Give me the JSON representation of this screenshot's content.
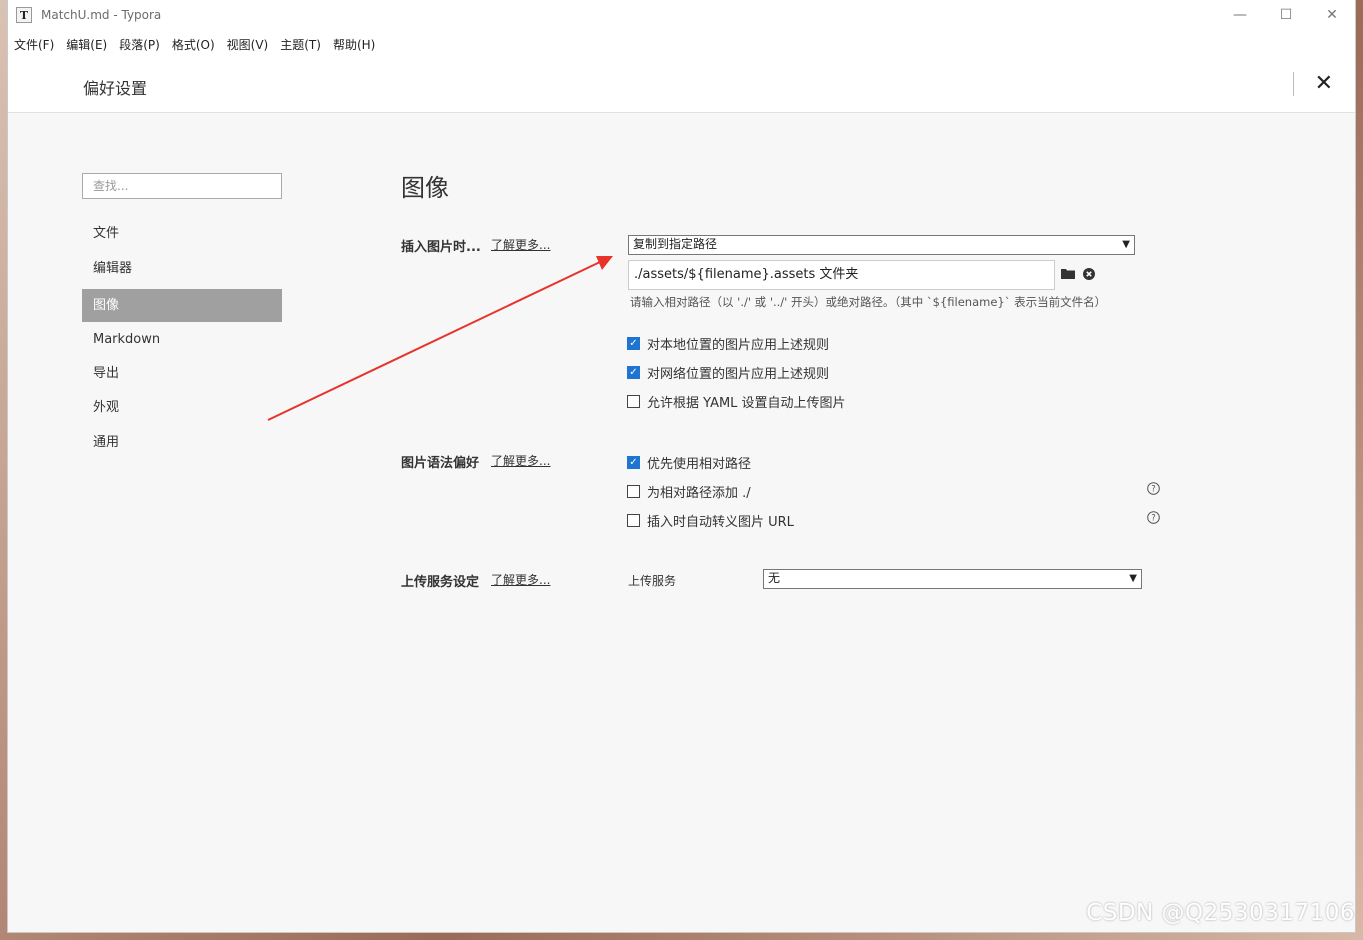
{
  "window": {
    "title": "MatchU.md - Typora",
    "app_icon_letter": "T",
    "controls": {
      "minimize": "—",
      "maximize": "☐",
      "close": "✕"
    }
  },
  "menubar": {
    "items": [
      "文件(F)",
      "编辑(E)",
      "段落(P)",
      "格式(O)",
      "视图(V)",
      "主题(T)",
      "帮助(H)"
    ]
  },
  "preferences": {
    "title": "偏好设置",
    "close_label": "✕"
  },
  "sidebar": {
    "search_placeholder": "查找...",
    "items": [
      {
        "label": "文件",
        "active": false
      },
      {
        "label": "编辑器",
        "active": false
      },
      {
        "label": "图像",
        "active": true
      },
      {
        "label": "Markdown",
        "active": false
      },
      {
        "label": "导出",
        "active": false
      },
      {
        "label": "外观",
        "active": false
      },
      {
        "label": "通用",
        "active": false
      }
    ]
  },
  "main": {
    "section_title": "图像",
    "learn_more": "了解更多...",
    "insert": {
      "label": "插入图片时...",
      "action_value": "复制到指定路径",
      "path_value": "./assets/${filename}.assets 文件夹",
      "hint": "请输入相对路径（以 './' 或 '../' 开头）或绝对路径。（其中 `${filename}` 表示当前文件名）",
      "options": [
        {
          "label": "对本地位置的图片应用上述规则",
          "checked": true
        },
        {
          "label": "对网络位置的图片应用上述规则",
          "checked": true
        },
        {
          "label": "允许根据 YAML 设置自动上传图片",
          "checked": false
        }
      ]
    },
    "syntax": {
      "label": "图片语法偏好",
      "options": [
        {
          "label": "优先使用相对路径",
          "checked": true,
          "help": false
        },
        {
          "label": "为相对路径添加 ./",
          "checked": false,
          "help": true
        },
        {
          "label": "插入时自动转义图片 URL",
          "checked": false,
          "help": true
        }
      ]
    },
    "upload": {
      "label": "上传服务设定",
      "service_label": "上传服务",
      "service_value": "无"
    }
  },
  "annotation": {
    "arrow_color": "#e8322a"
  },
  "watermark": "CSDN @Q2530317106",
  "colors": {
    "accent": "#1e74d0",
    "active_nav": "#a0a0a0"
  }
}
